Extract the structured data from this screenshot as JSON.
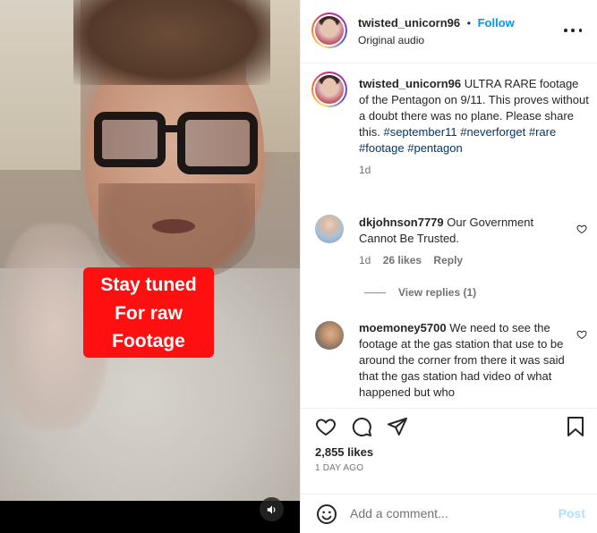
{
  "post": {
    "username": "twisted_unicorn96",
    "separator": "•",
    "follow_label": "Follow",
    "audio": "Original audio"
  },
  "video": {
    "caption_lines": [
      "Stay tuned",
      "For raw",
      "Footage"
    ],
    "sound_icon": "speaker-icon"
  },
  "caption": {
    "username": "twisted_unicorn96",
    "text": "ULTRA RARE footage of the Pentagon on 9/11. This proves without a doubt there was no plane. Please share this.",
    "hashtags": [
      "#september11",
      "#neverforget",
      "#rare",
      "#footage",
      "#pentagon"
    ],
    "age": "1d"
  },
  "comments": [
    {
      "username": "dkjohnson7779",
      "text": "Our Government Cannot Be Trusted.",
      "age": "1d",
      "likes": "26 likes",
      "reply_label": "Reply",
      "view_replies": "View replies (1)"
    },
    {
      "username": "moemoney5700",
      "text": "We need to see the footage at the gas station that use to be around the corner from there it was said that the gas station had video of what happened but who"
    }
  ],
  "actions": {
    "likes": "2,855 likes",
    "timestamp": "1 DAY AGO"
  },
  "add_comment": {
    "placeholder": "Add a comment...",
    "post_label": "Post"
  },
  "colors": {
    "follow": "#0095f6",
    "hashtag": "#00376b",
    "caption_box": "#ff0f0f",
    "post_disabled": "#b2dffc"
  }
}
